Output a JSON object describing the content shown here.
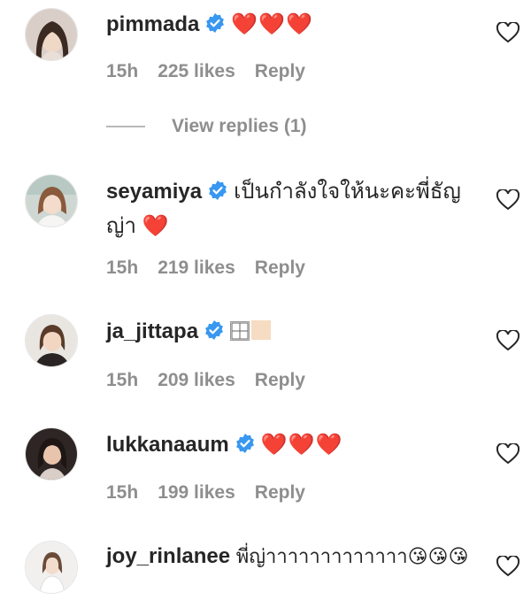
{
  "comments": [
    {
      "username": "pimmada",
      "text": "❤️❤️❤️",
      "time": "15h",
      "likes": "225 likes",
      "reply": "Reply",
      "view_replies": "View replies (1)"
    },
    {
      "username": "seyamiya",
      "text": "เป็นกำลังใจให้นะคะพี่ธัญญ่า ❤️",
      "time": "15h",
      "likes": "219 likes",
      "reply": "Reply"
    },
    {
      "username": "ja_jittapa",
      "text": "",
      "time": "15h",
      "likes": "209 likes",
      "reply": "Reply"
    },
    {
      "username": "lukkanaaum",
      "text": "❤️❤️❤️",
      "time": "15h",
      "likes": "199 likes",
      "reply": "Reply"
    },
    {
      "username": "joy_rinlanee",
      "text": "พี่ญ่าาาาาาาาาาาาา😘😘😘",
      "time": "",
      "likes": "",
      "reply": ""
    }
  ],
  "icons": {
    "verified": "verified-badge-icon",
    "like": "heart-outline-icon"
  },
  "colors": {
    "text": "#262626",
    "meta": "#8e8e8e",
    "verified": "#3897f0",
    "heart": "#ed3446"
  }
}
